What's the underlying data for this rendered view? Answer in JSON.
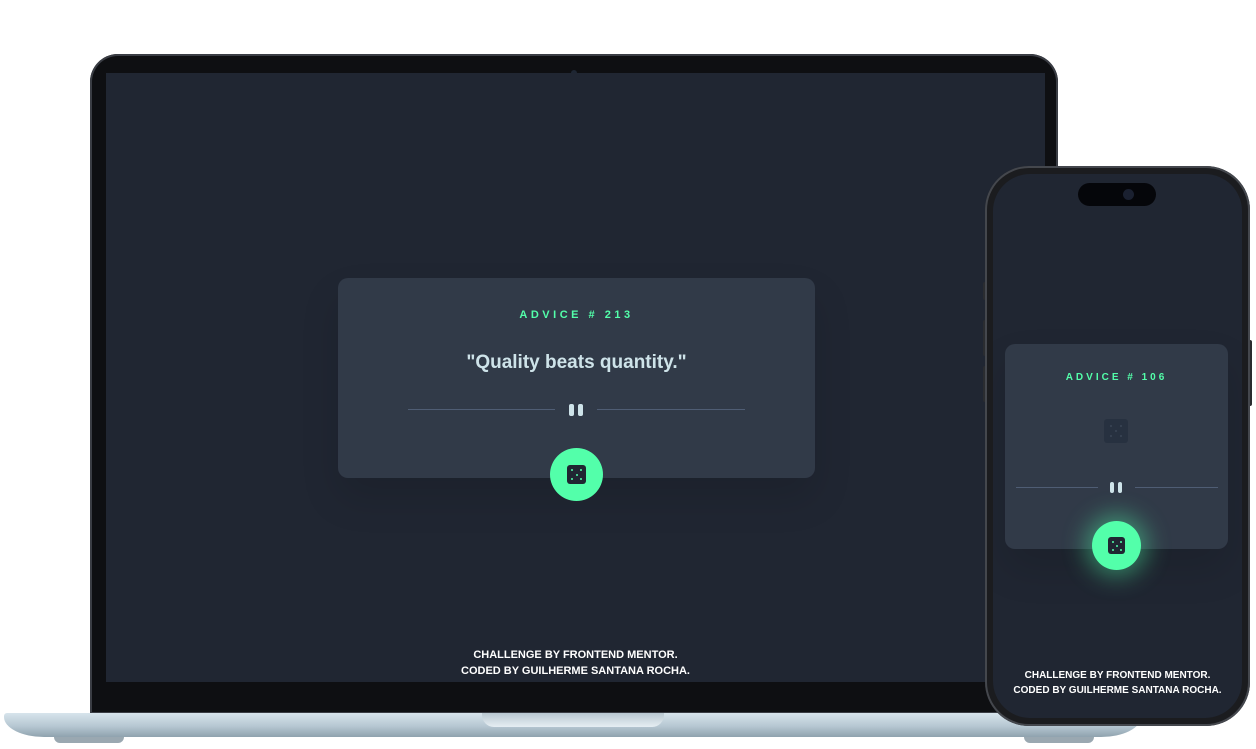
{
  "colors": {
    "background": "#202632",
    "card": "#313a48",
    "accent": "#53ffaa",
    "text": "#cee3e9",
    "divider": "#4f5d74"
  },
  "desktop": {
    "advice_label": "ADVICE # 213",
    "quote": "\"Quality beats quantity.\"",
    "divider_icon": "pause-icon",
    "button_icon": "dice-icon",
    "footer": {
      "line1": "CHALLENGE BY FRONTEND MENTOR.",
      "line2": "CODED BY GUILHERME SANTANA ROCHA."
    }
  },
  "mobile": {
    "advice_label": "ADVICE # 106",
    "loading_icon": "dice-loading-icon",
    "divider_icon": "pause-icon",
    "button_icon": "dice-icon",
    "footer": {
      "line1": "CHALLENGE BY FRONTEND MENTOR.",
      "line2": "CODED BY GUILHERME SANTANA ROCHA."
    }
  }
}
